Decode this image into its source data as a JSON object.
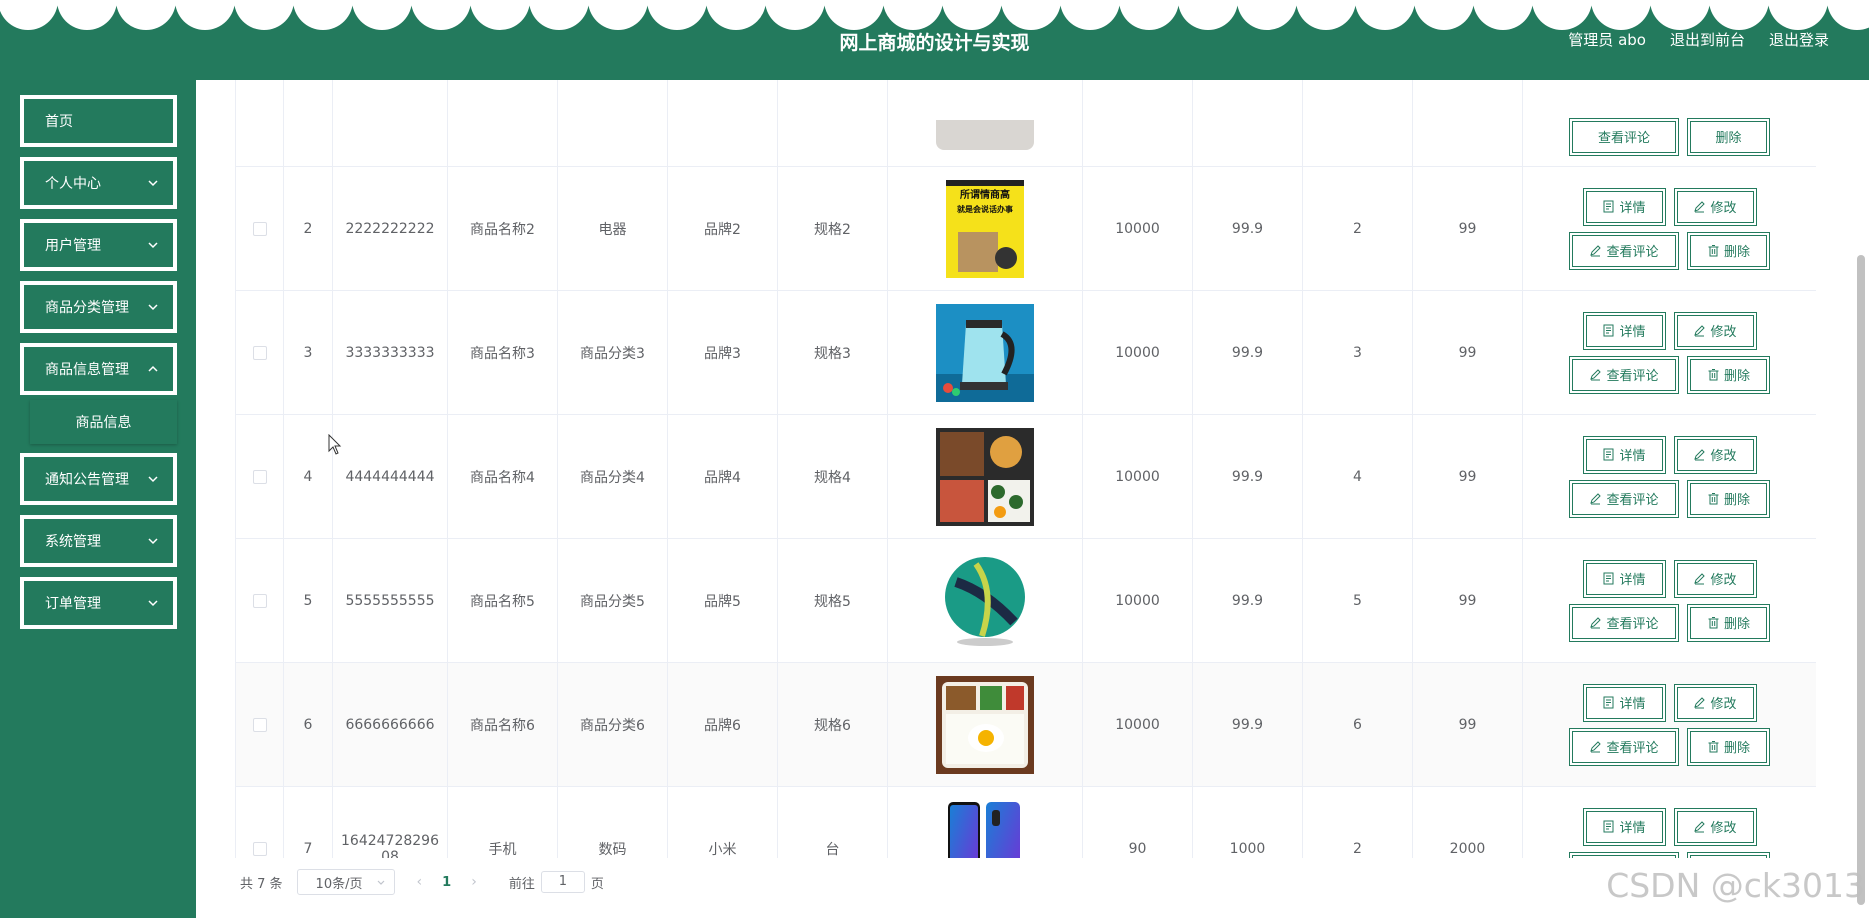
{
  "header": {
    "title": "网上商城的设计与实现",
    "user": "管理员 abo",
    "to_front": "退出到前台",
    "logout": "退出登录"
  },
  "sidebar": {
    "items": [
      {
        "label": "首页"
      },
      {
        "label": "个人中心"
      },
      {
        "label": "用户管理"
      },
      {
        "label": "商品分类管理"
      },
      {
        "label": "商品信息管理"
      },
      {
        "label": "通知公告管理"
      },
      {
        "label": "系统管理"
      },
      {
        "label": "订单管理"
      }
    ],
    "sub_item": "商品信息"
  },
  "table": {
    "rows": [
      {
        "index": "2",
        "code": "2222222222",
        "name": "商品名称2",
        "category": "电器",
        "brand": "品牌2",
        "spec": "规格2",
        "image": "book-cover",
        "c1": "10000",
        "c2": "99.9",
        "c3": "2",
        "c4": "99"
      },
      {
        "index": "3",
        "code": "3333333333",
        "name": "商品名称3",
        "category": "商品分类3",
        "brand": "品牌3",
        "spec": "规格3",
        "image": "electric-kettle",
        "c1": "10000",
        "c2": "99.9",
        "c3": "3",
        "c4": "99"
      },
      {
        "index": "4",
        "code": "4444444444",
        "name": "商品名称4",
        "category": "商品分类4",
        "brand": "品牌4",
        "spec": "规格4",
        "image": "bento-box",
        "c1": "10000",
        "c2": "99.9",
        "c3": "4",
        "c4": "99"
      },
      {
        "index": "5",
        "code": "5555555555",
        "name": "商品名称5",
        "category": "商品分类5",
        "brand": "品牌5",
        "spec": "规格5",
        "image": "soccer-ball",
        "c1": "10000",
        "c2": "99.9",
        "c3": "5",
        "c4": "99"
      },
      {
        "index": "6",
        "code": "6666666666",
        "name": "商品名称6",
        "category": "商品分类6",
        "brand": "品牌6",
        "spec": "规格6",
        "image": "rice-bento",
        "c1": "10000",
        "c2": "99.9",
        "c3": "6",
        "c4": "99"
      },
      {
        "index": "7",
        "code": "1642472829608",
        "name": "手机",
        "category": "数码",
        "brand": "小米",
        "spec": "台",
        "image": "phone",
        "c1": "90",
        "c2": "1000",
        "c3": "2",
        "c4": "2000"
      }
    ],
    "actions": {
      "detail": "详情",
      "edit": "修改",
      "comments": "查看评论",
      "delete": "删除"
    },
    "book_text": "所谓情商高就是会说话办事"
  },
  "pager": {
    "total": "共 7 条",
    "page_size": "10条/页",
    "current": "1",
    "goto_label": "前往",
    "goto_value": "1",
    "page_suffix": "页"
  },
  "watermark": "CSDN @ck3013",
  "colors": {
    "brand": "#237a5d",
    "border": "#ebeef5",
    "text": "#606266"
  }
}
